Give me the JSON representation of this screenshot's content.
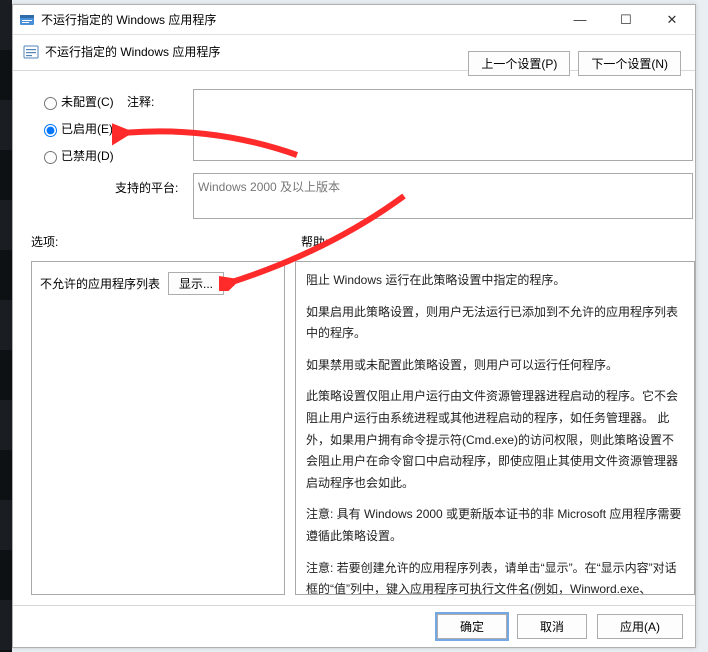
{
  "window": {
    "title": "不运行指定的 Windows 应用程序",
    "min_symbol": "—",
    "max_symbol": "☐",
    "close_symbol": "✕"
  },
  "header": {
    "title": "不运行指定的 Windows 应用程序",
    "prev_setting": "上一个设置(P)",
    "next_setting": "下一个设置(N)"
  },
  "radios": {
    "not_configured": "未配置(C)",
    "enabled": "已启用(E)",
    "disabled": "已禁用(D)",
    "selected": "enabled"
  },
  "labels": {
    "comment": "注释:",
    "platform": "支持的平台:",
    "options": "选项:",
    "help": "帮助:"
  },
  "platform_text": "Windows 2000 及以上版本",
  "options": {
    "list_label": "不允许的应用程序列表",
    "show_button": "显示..."
  },
  "help_paragraphs": [
    "阻止 Windows 运行在此策略设置中指定的程序。",
    "如果启用此策略设置，则用户无法运行已添加到不允许的应用程序列表中的程序。",
    "如果禁用或未配置此策略设置，则用户可以运行任何程序。",
    "此策略设置仅阻止用户运行由文件资源管理器进程启动的程序。它不会阻止用户运行由系统进程或其他进程启动的程序，如任务管理器。 此外，如果用户拥有命令提示符(Cmd.exe)的访问权限，则此策略设置不会阻止用户在命令窗口中启动程序，即使应阻止其使用文件资源管理器启动程序也会如此。",
    "注意: 具有 Windows 2000 或更新版本证书的非 Microsoft 应用程序需要遵循此策略设置。",
    "注意: 若要创建允许的应用程序列表，请单击“显示”。在“显示内容”对话框的“值”列中，键入应用程序可执行文件名(例如，Winword.exe、Poledit.exe 和 Powerpnt.exe)。"
  ],
  "footer": {
    "ok": "确定",
    "cancel": "取消",
    "apply": "应用(A)"
  }
}
